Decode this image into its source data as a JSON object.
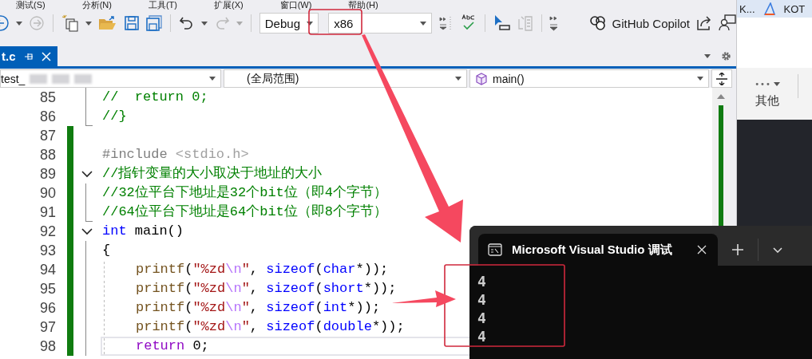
{
  "menu": [
    "测试(S)",
    "分析(N)",
    "工具(T)",
    "扩展(X)",
    "窗口(W)",
    "帮助(H)"
  ],
  "toolbar": {
    "configuration": "Debug",
    "platform": "x86",
    "copilot": "GitHub Copilot"
  },
  "document_tab": {
    "label": "t.c",
    "selected": true
  },
  "navigation": {
    "project": "test_",
    "scope": "(全局范围)",
    "member": "main()"
  },
  "editor": {
    "lines": [
      {
        "number": "85",
        "kind": "line",
        "changed": false,
        "current": false,
        "tokens": [
          {
            "kind": "comment",
            "text": "//  return 0;"
          }
        ]
      },
      {
        "number": "86",
        "kind": "end",
        "changed": false,
        "current": false,
        "tokens": [
          {
            "kind": "comment",
            "text": "//}"
          }
        ]
      },
      {
        "number": "87",
        "kind": "plain",
        "changed": true,
        "current": false
      },
      {
        "number": "88",
        "kind": "plain",
        "changed": true,
        "current": false,
        "tokens": [
          {
            "kind": "preproc",
            "text": "#include "
          },
          {
            "kind": "header",
            "text": "<stdio.h>"
          }
        ]
      },
      {
        "number": "89",
        "kind": "expanded",
        "changed": true,
        "current": false,
        "tokens": [
          {
            "kind": "comment",
            "text": "//指针变量的大小取决于地址的大小"
          }
        ]
      },
      {
        "number": "90",
        "kind": "line",
        "changed": true,
        "current": false,
        "tokens": [
          {
            "kind": "comment",
            "text": "//32位平台下地址是32个bit位（即4个字节）"
          }
        ]
      },
      {
        "number": "91",
        "kind": "end",
        "changed": true,
        "current": false,
        "tokens": [
          {
            "kind": "comment",
            "text": "//64位平台下地址是64个bit位（即8个字节）"
          }
        ]
      },
      {
        "number": "92",
        "kind": "expanded",
        "changed": true,
        "current": false,
        "tokens": [
          {
            "kind": "keyword",
            "text": "int"
          },
          {
            "kind": "plain",
            "text": " main()"
          }
        ]
      },
      {
        "number": "93",
        "kind": "line",
        "changed": true,
        "current": false,
        "tokens": [
          {
            "kind": "plain",
            "text": "{"
          }
        ]
      },
      {
        "number": "94",
        "kind": "inner",
        "changed": true,
        "current": false,
        "tokens": [
          {
            "kind": "function",
            "text": "printf"
          },
          {
            "kind": "plain",
            "text": "("
          },
          {
            "kind": "string",
            "text": "\"%zd"
          },
          {
            "kind": "escape",
            "text": "\\n"
          },
          {
            "kind": "string",
            "text": "\""
          },
          {
            "kind": "plain",
            "text": ", "
          },
          {
            "kind": "keyword",
            "text": "sizeof"
          },
          {
            "kind": "plain",
            "text": "("
          },
          {
            "kind": "keyword",
            "text": "char"
          },
          {
            "kind": "plain",
            "text": "*));"
          }
        ]
      },
      {
        "number": "95",
        "kind": "inner",
        "changed": true,
        "current": false,
        "tokens": [
          {
            "kind": "function",
            "text": "printf"
          },
          {
            "kind": "plain",
            "text": "("
          },
          {
            "kind": "string",
            "text": "\"%zd"
          },
          {
            "kind": "escape",
            "text": "\\n"
          },
          {
            "kind": "string",
            "text": "\""
          },
          {
            "kind": "plain",
            "text": ", "
          },
          {
            "kind": "keyword",
            "text": "sizeof"
          },
          {
            "kind": "plain",
            "text": "("
          },
          {
            "kind": "keyword",
            "text": "short"
          },
          {
            "kind": "plain",
            "text": "*));"
          }
        ]
      },
      {
        "number": "96",
        "kind": "inner",
        "changed": true,
        "current": false,
        "tokens": [
          {
            "kind": "function",
            "text": "printf"
          },
          {
            "kind": "plain",
            "text": "("
          },
          {
            "kind": "string",
            "text": "\"%zd"
          },
          {
            "kind": "escape",
            "text": "\\n"
          },
          {
            "kind": "string",
            "text": "\""
          },
          {
            "kind": "plain",
            "text": ", "
          },
          {
            "kind": "keyword",
            "text": "sizeof"
          },
          {
            "kind": "plain",
            "text": "("
          },
          {
            "kind": "keyword",
            "text": "int"
          },
          {
            "kind": "plain",
            "text": "*));"
          }
        ]
      },
      {
        "number": "97",
        "kind": "inner",
        "changed": true,
        "current": false,
        "tokens": [
          {
            "kind": "function",
            "text": "printf"
          },
          {
            "kind": "plain",
            "text": "("
          },
          {
            "kind": "string",
            "text": "\"%zd"
          },
          {
            "kind": "escape",
            "text": "\\n"
          },
          {
            "kind": "string",
            "text": "\""
          },
          {
            "kind": "plain",
            "text": ", "
          },
          {
            "kind": "keyword",
            "text": "sizeof"
          },
          {
            "kind": "plain",
            "text": "("
          },
          {
            "kind": "keyword",
            "text": "double"
          },
          {
            "kind": "plain",
            "text": "*));"
          }
        ]
      },
      {
        "number": "98",
        "kind": "inner",
        "changed": true,
        "current": true,
        "tokens": [
          {
            "kind": "control",
            "text": "return"
          },
          {
            "kind": "plain",
            "text": " 0;"
          }
        ]
      }
    ]
  },
  "console": {
    "title": "Microsoft Visual Studio 调试",
    "output": [
      "4",
      "4",
      "4",
      "4"
    ]
  },
  "side_panel": {
    "tabs": [
      "K...",
      "KOT"
    ],
    "more": "•••",
    "label": "其他"
  }
}
